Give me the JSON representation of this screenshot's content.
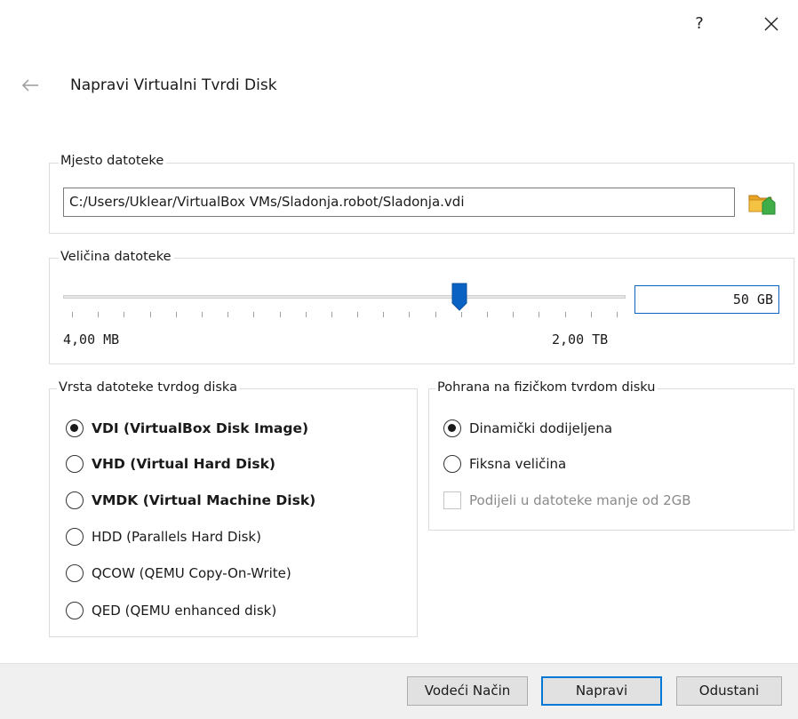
{
  "titlebar": {
    "help_label": "?",
    "close_icon": "close-icon"
  },
  "page": {
    "title": "Napravi Virtualni Tvrdi Disk",
    "back_icon": "arrow-left-icon"
  },
  "location": {
    "group_title": "Mjesto datoteke",
    "path": "C:/Users/Uklear/VirtualBox VMs/Sladonja.robot/Sladonja.vdi",
    "folder_icon": "folder-open-icon"
  },
  "size": {
    "group_title": "Veličina datoteke",
    "value": "50 GB",
    "min_label": "4,00 MB",
    "max_label": "2,00 TB",
    "slider_fraction": 0.705
  },
  "disk_type": {
    "group_title": "Vrsta datoteke tvrdog diska",
    "options": [
      {
        "label": "VDI (VirtualBox Disk Image)",
        "checked": true,
        "bold": true
      },
      {
        "label": "VHD (Virtual Hard Disk)",
        "checked": false,
        "bold": true
      },
      {
        "label": "VMDK (Virtual Machine Disk)",
        "checked": false,
        "bold": true
      },
      {
        "label": "HDD (Parallels Hard Disk)",
        "checked": false,
        "bold": false
      },
      {
        "label": "QCOW (QEMU Copy-On-Write)",
        "checked": false,
        "bold": false
      },
      {
        "label": "QED (QEMU enhanced disk)",
        "checked": false,
        "bold": false
      }
    ]
  },
  "storage": {
    "group_title": "Pohrana na fizičkom tvrdom disku",
    "options": [
      {
        "label": "Dinamički dodijeljena",
        "checked": true
      },
      {
        "label": "Fiksna veličina",
        "checked": false
      }
    ],
    "split_label": "Podijeli u datoteke manje od 2GB",
    "split_checked": false,
    "split_enabled": false
  },
  "footer": {
    "guided_label": "Vodeći Način",
    "create_label": "Napravi",
    "cancel_label": "Odustani"
  },
  "colors": {
    "accent": "#0078d7",
    "slider_thumb": "#0a62c2",
    "footer_bg": "#f0f0f0"
  }
}
